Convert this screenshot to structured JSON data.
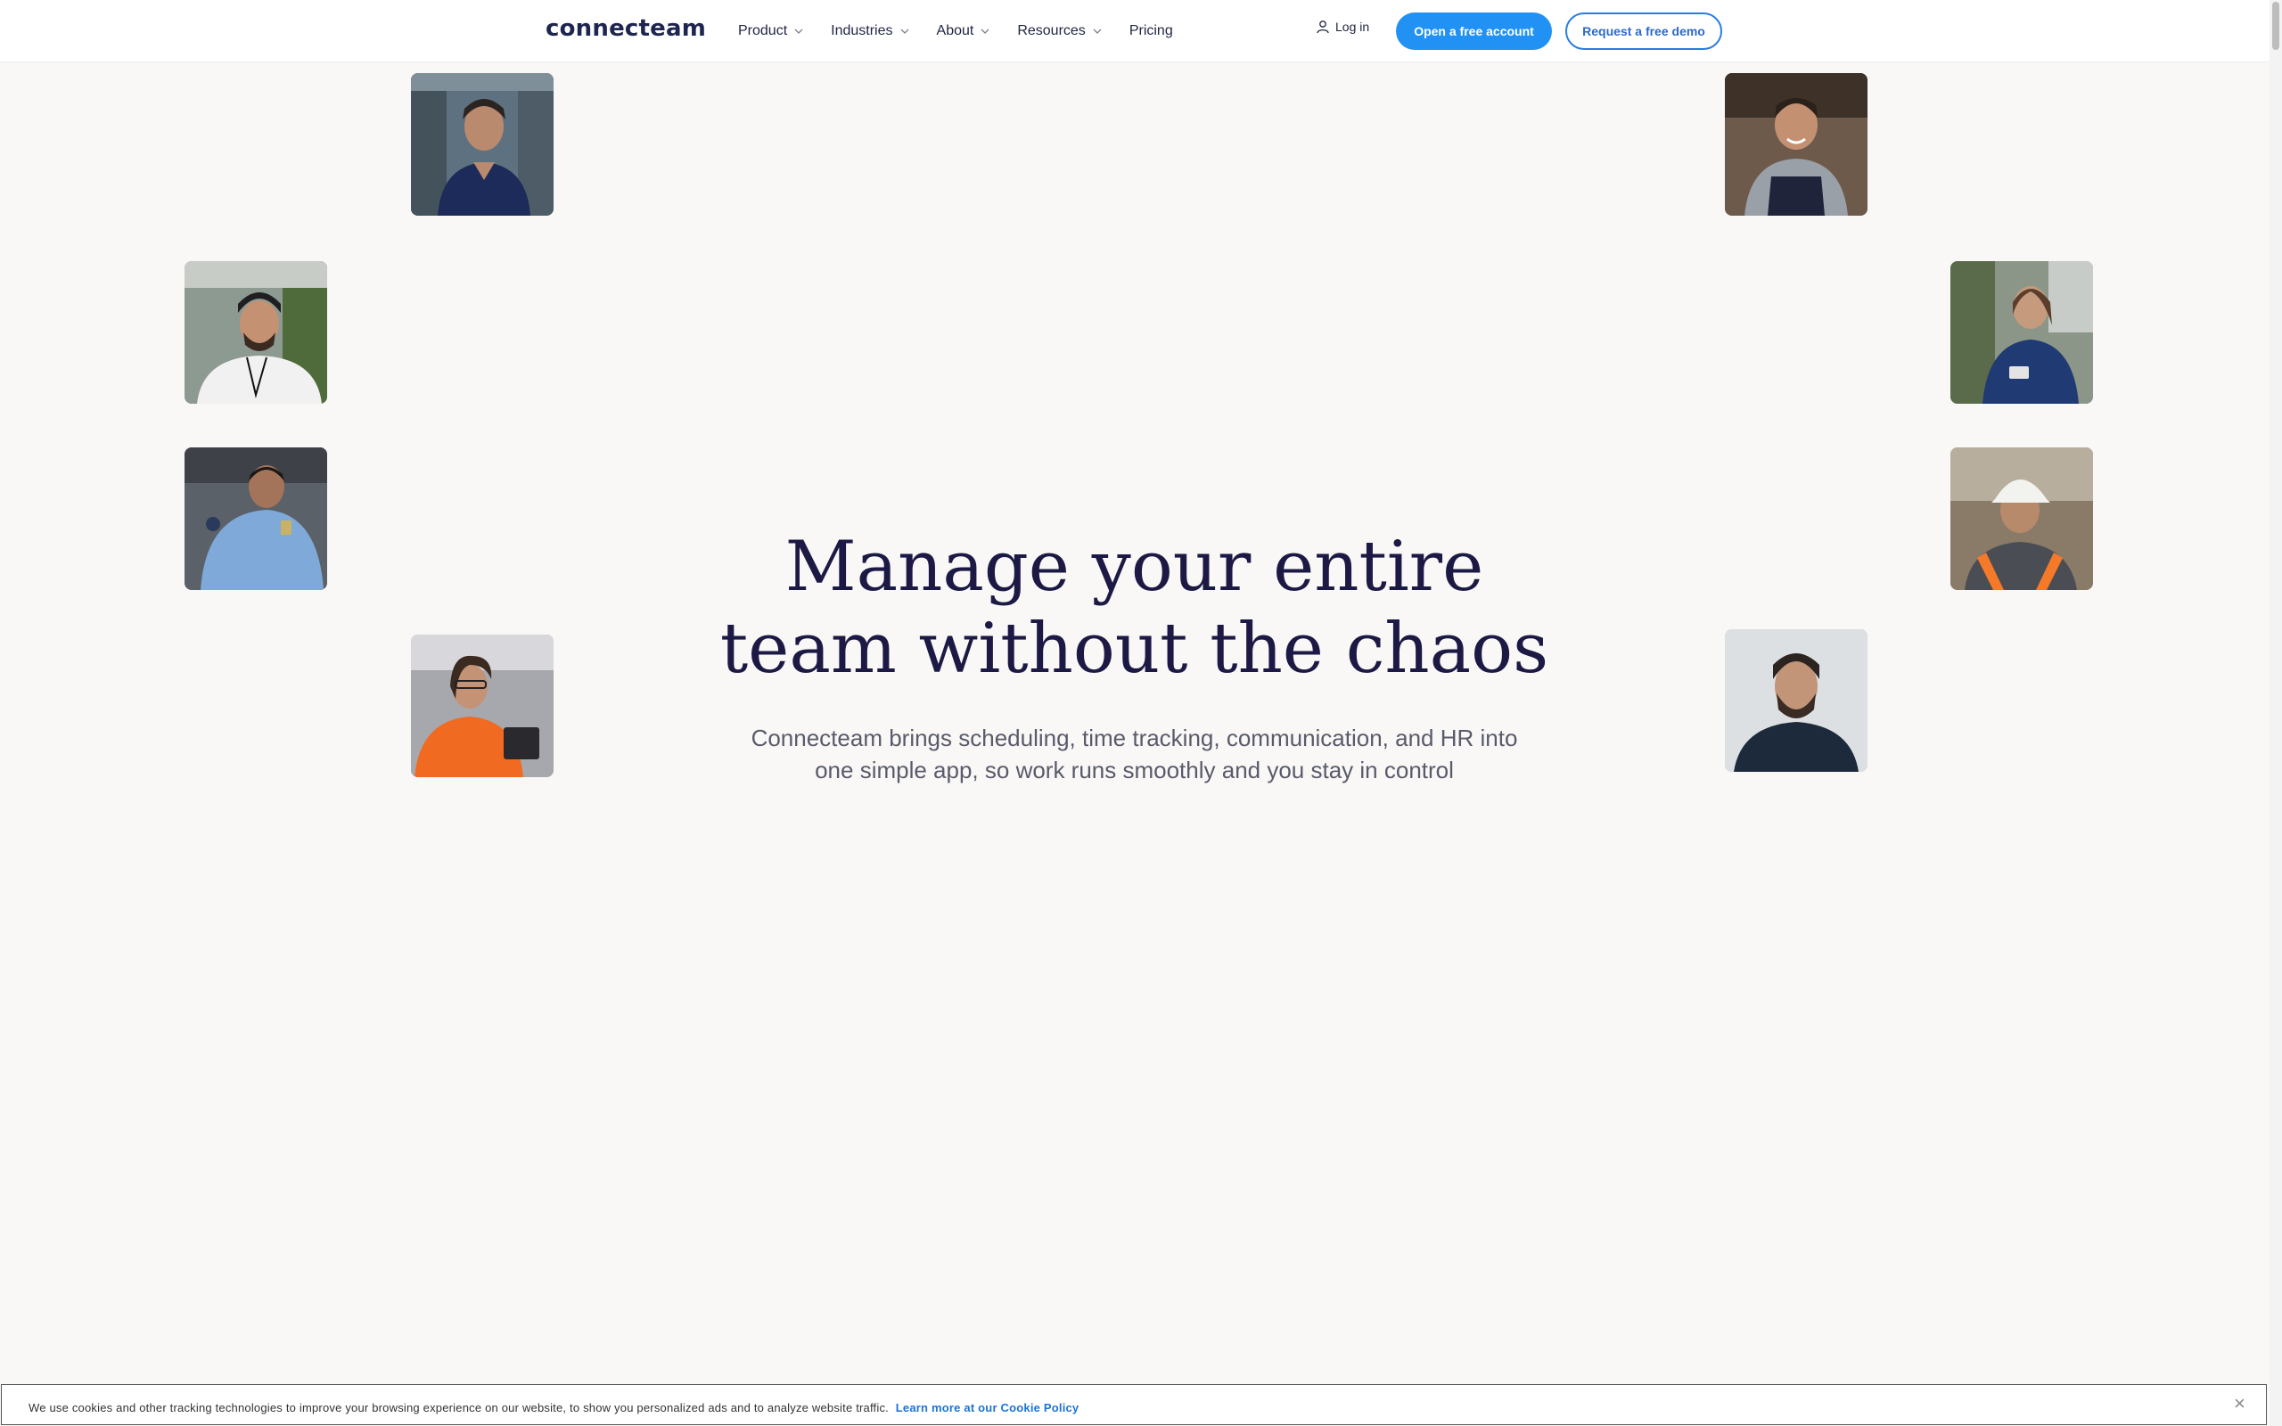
{
  "header": {
    "logo": "connecteam",
    "nav": [
      {
        "label": "Product",
        "dropdown": true
      },
      {
        "label": "Industries",
        "dropdown": true
      },
      {
        "label": "About",
        "dropdown": true
      },
      {
        "label": "Resources",
        "dropdown": true
      },
      {
        "label": "Pricing",
        "dropdown": false
      }
    ],
    "login_label": "Log in",
    "primary_cta": "Open a free account",
    "secondary_cta": "Request a free demo"
  },
  "hero": {
    "title_line1": "Manage your entire",
    "title_line2": "team without the chaos",
    "subtitle_line1": "Connecteam brings scheduling, time tracking, communication, and HR into",
    "subtitle_line2": "one simple app, so work runs smoothly and you stay in control"
  },
  "photos": [
    {
      "subject": "healthcare worker in navy scrubs"
    },
    {
      "subject": "smiling chef in apron"
    },
    {
      "subject": "worker with beanie and lanyard"
    },
    {
      "subject": "nurse looking at phone"
    },
    {
      "subject": "security officer in blue uniform"
    },
    {
      "subject": "construction worker in hard hat"
    },
    {
      "subject": "warehouse worker with safety glasses"
    },
    {
      "subject": "bearded man portrait"
    }
  ],
  "cookie": {
    "text": "We use cookies and other tracking technologies to improve your browsing experience on our website, to show you personalized ads and to analyze website traffic.",
    "link": "Learn more at our Cookie Policy",
    "close_icon": "close-icon"
  },
  "colors": {
    "accent": "#2192f3",
    "title": "#1c1a44",
    "background": "#f9f8f7"
  }
}
